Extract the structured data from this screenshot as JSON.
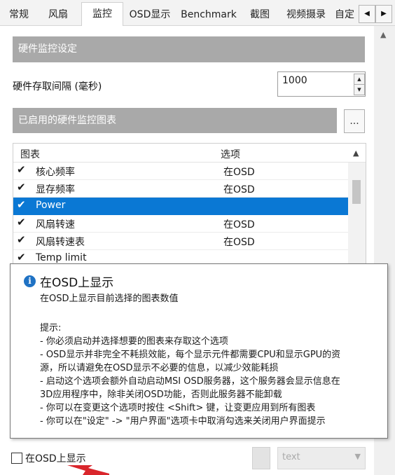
{
  "tabs": [
    "常规",
    "风扇",
    "监控",
    "OSD显示",
    "Benchmark",
    "截图",
    "视频摄录",
    "自定"
  ],
  "active_tab": "监控",
  "tab_nav": {
    "prev_glyph": "◀",
    "next_glyph": "▶"
  },
  "section_hardware": "硬件监控设定",
  "polling_label": "硬件存取间隔 (毫秒)",
  "polling_value": "1000",
  "section_graphs": "已启用的硬件监控图表",
  "graphs_more": "...",
  "list_headers": {
    "graph": "图表",
    "option": "选项"
  },
  "list_rows": [
    {
      "checked": true,
      "name": "核心频率",
      "option": "在OSD",
      "selected": false
    },
    {
      "checked": true,
      "name": "显存频率",
      "option": "在OSD",
      "selected": false
    },
    {
      "checked": true,
      "name": "Power",
      "option": "",
      "selected": true
    },
    {
      "checked": true,
      "name": "风扇转速",
      "option": "在OSD",
      "selected": false
    },
    {
      "checked": true,
      "name": "风扇转速表",
      "option": "在OSD",
      "selected": false
    },
    {
      "checked": true,
      "name": "Temp limit",
      "option": "",
      "selected": false
    }
  ],
  "tooltip": {
    "title": "在OSD上显示",
    "subtitle": "在OSD上显示目前选择的图表数值",
    "lines": [
      "提示:",
      "- 你必须启动并选择想要的图表来存取这个选项",
      "- OSD显示并非完全不耗损效能，每个显示元件都需要CPU和显示GPU的资",
      "源，所以请避免在OSD显示不必要的信息，以减少效能耗损",
      "- 启动这个选项会额外自动启动MSI OSD服务器，这个服务器会显示信息在",
      "3D应用程序中，除非关闭OSD功能，否则此服务器不能卸载",
      "- 你可以在变更这个选项时按住 <Shift> 键，让变更应用到所有图表",
      "- 你可以在\"设定\" -> \"用户界面\"选项卡中取消勾选来关闭用户界面提示"
    ]
  },
  "show_in_osd_label": "在OSD上显示",
  "show_in_osd_checked": false,
  "osd_type_value": "text",
  "accent_color": "#0a78d4",
  "annotation_color": "#d9262c"
}
